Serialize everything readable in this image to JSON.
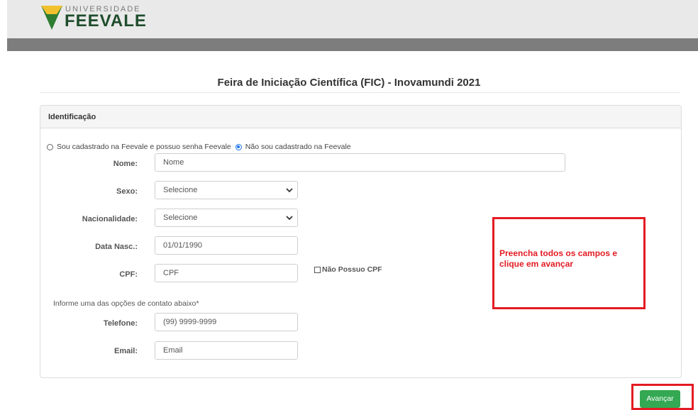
{
  "header": {
    "logo_small": "UNIVERSIDADE",
    "logo_big": "FEEVALE",
    "logo_icon": "feevale-shield-icon"
  },
  "page_title": "Feira de Iniciação Científica (FIC) - Inovamundi 2021",
  "panel": {
    "title": "Identificação",
    "radio_options": [
      {
        "label": "Sou cadastrado na Feevale e possuo senha Feevale",
        "checked": false
      },
      {
        "label": "Não sou cadastrado na Feevale",
        "checked": true
      }
    ],
    "fields": {
      "nome": {
        "label": "Nome:",
        "placeholder": "Nome"
      },
      "sexo": {
        "label": "Sexo:",
        "value": "Selecione"
      },
      "nacionalidade": {
        "label": "Nacionalidade:",
        "value": "Selecione"
      },
      "data_nasc": {
        "label": "Data Nasc.:",
        "placeholder": "01/01/1990"
      },
      "cpf": {
        "label": "CPF:",
        "placeholder": "CPF"
      },
      "nao_possuo_cpf": {
        "label": "Não Possuo CPF",
        "checked": false
      },
      "contact_note": "Informe uma das opções de contato abaixo*",
      "telefone": {
        "label": "Telefone:",
        "placeholder": "(99) 9999-9999"
      },
      "email": {
        "label": "Email:",
        "placeholder": "Email"
      }
    }
  },
  "annotation": {
    "text_line1": "Preencha todos os campos e",
    "text_line2": "clique em avançar",
    "color": "#e31b23"
  },
  "actions": {
    "next_label": "Avançar",
    "next_color": "#34a853"
  }
}
